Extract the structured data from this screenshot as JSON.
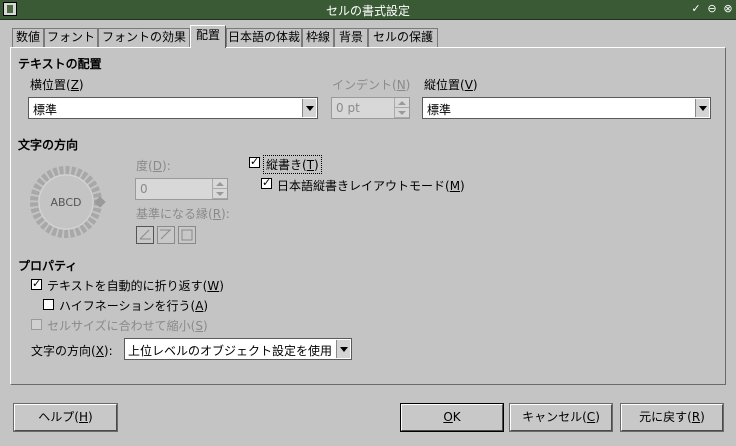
{
  "window": {
    "title": "セルの書式設定",
    "controls": [
      "✓",
      "⊖",
      "⊗"
    ]
  },
  "tabs": [
    {
      "label": "数値",
      "active": false
    },
    {
      "label": "フォント",
      "active": false
    },
    {
      "label": "フォントの効果",
      "active": false
    },
    {
      "label": "配置",
      "active": true
    },
    {
      "label": "日本語の体裁",
      "active": false
    },
    {
      "label": "枠線",
      "active": false
    },
    {
      "label": "背景",
      "active": false
    },
    {
      "label": "セルの保護",
      "active": false
    }
  ],
  "text_alignment": {
    "heading": "テキストの配置",
    "horizontal_label": "横位置(",
    "horizontal_key": "Z",
    "horizontal_value": "標準",
    "indent_label": "インデント(",
    "indent_key": "N",
    "indent_value": "0 pt",
    "vertical_label": "縦位置(",
    "vertical_key": "V",
    "vertical_value": "標準"
  },
  "text_orientation": {
    "heading": "文字の方向",
    "dial_text": "ABCD",
    "degrees_label": "度(",
    "degrees_key": "D",
    "degrees_value": "0",
    "reference_edge_label": "基準になる縁(",
    "reference_edge_key": "R",
    "vertical_stacked_label": "縦書き(",
    "vertical_stacked_key": "T",
    "vertical_stacked_checked": true,
    "asian_layout_label": "日本語縦書きレイアウトモード(",
    "asian_layout_key": "M",
    "asian_layout_checked": true
  },
  "properties": {
    "heading": "プロパティ",
    "wrap_label": "テキストを自動的に折り返す(",
    "wrap_key": "W",
    "wrap_checked": true,
    "hyphen_label": "ハイフネーションを行う(",
    "hyphen_key": "A",
    "hyphen_checked": false,
    "shrink_label": "セルサイズに合わせて縮小(",
    "shrink_key": "S",
    "shrink_checked": false,
    "direction_label": "文字の方向(",
    "direction_key": "X",
    "direction_value": "上位レベルのオブジェクト設定を使用"
  },
  "buttons": {
    "help_label": "ヘルプ(",
    "help_key": "H",
    "ok_key": "O",
    "ok_rest": "K",
    "cancel_label": "キャンセル(",
    "cancel_key": "C",
    "reset_label": "元に戻す(",
    "reset_key": "R"
  },
  "colors": {
    "titlebar": "#3a5a35",
    "dialog_bg": "#c4c4c4"
  }
}
